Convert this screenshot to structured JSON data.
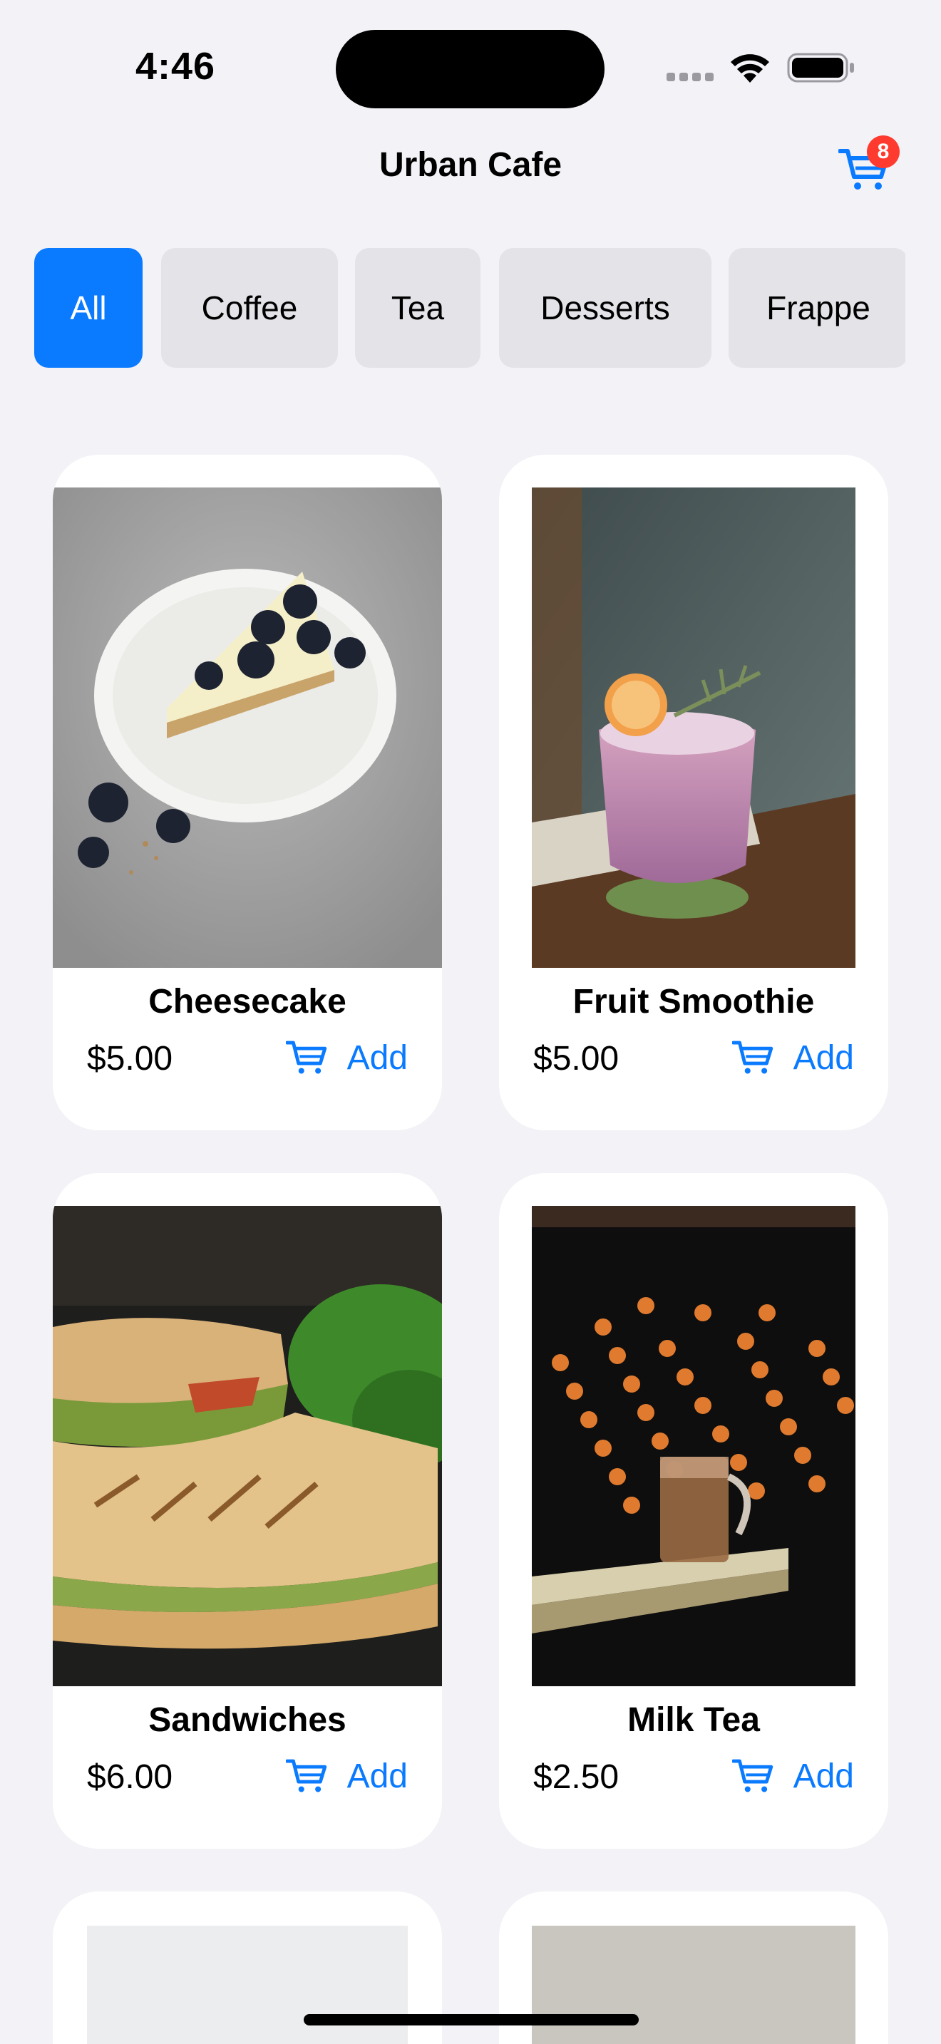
{
  "status_bar": {
    "time": "4:46"
  },
  "header": {
    "title": "Urban Cafe",
    "cart_count": "8"
  },
  "categories": [
    "All",
    "Coffee",
    "Tea",
    "Desserts",
    "Frappe"
  ],
  "products": [
    {
      "name": "Cheesecake",
      "price": "$5.00",
      "add_label": "Add"
    },
    {
      "name": "Fruit Smoothie",
      "price": "$5.00",
      "add_label": "Add"
    },
    {
      "name": "Sandwiches",
      "price": "$6.00",
      "add_label": "Add"
    },
    {
      "name": "Milk Tea",
      "price": "$2.50",
      "add_label": "Add"
    }
  ],
  "colors": {
    "accent": "#0A7AFF",
    "badge": "#FF3B30",
    "background": "#F2F2F7"
  }
}
